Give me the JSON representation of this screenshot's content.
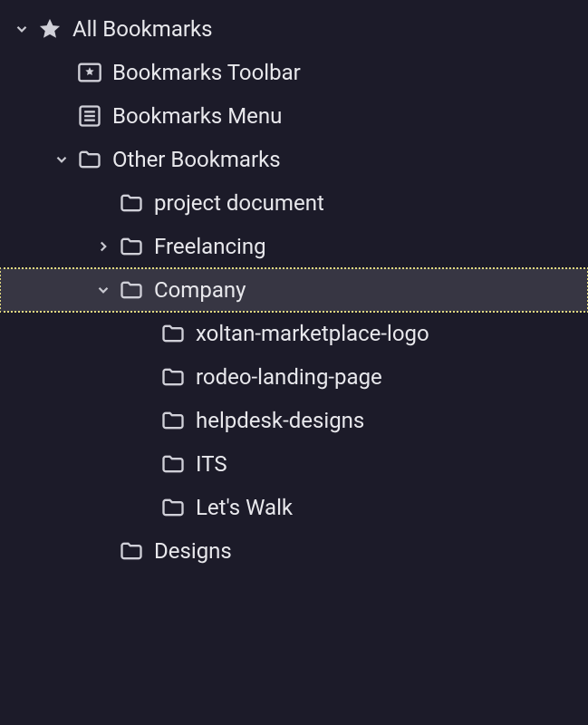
{
  "tree": {
    "root": {
      "label": "All Bookmarks",
      "icon": "star-icon",
      "expanded": true,
      "children": [
        {
          "label": "Bookmarks Toolbar",
          "icon": "toolbar-icon",
          "children": null
        },
        {
          "label": "Bookmarks Menu",
          "icon": "menu-icon",
          "children": null
        },
        {
          "label": "Other Bookmarks",
          "icon": "folder-icon",
          "expanded": true,
          "children": [
            {
              "label": "project document",
              "icon": "folder-icon",
              "children": null
            },
            {
              "label": "Freelancing",
              "icon": "folder-icon",
              "expanded": false,
              "children": []
            },
            {
              "label": "Company",
              "icon": "folder-icon",
              "expanded": true,
              "selected": true,
              "children": [
                {
                  "label": "xoltan-marketplace-logo",
                  "icon": "folder-icon",
                  "children": null
                },
                {
                  "label": "rodeo-landing-page",
                  "icon": "folder-icon",
                  "children": null
                },
                {
                  "label": "helpdesk-designs",
                  "icon": "folder-icon",
                  "children": null
                },
                {
                  "label": "ITS",
                  "icon": "folder-icon",
                  "children": null
                },
                {
                  "label": "Let's Walk",
                  "icon": "folder-icon",
                  "children": null
                }
              ]
            },
            {
              "label": "Designs",
              "icon": "folder-icon",
              "children": null
            }
          ]
        }
      ]
    }
  }
}
